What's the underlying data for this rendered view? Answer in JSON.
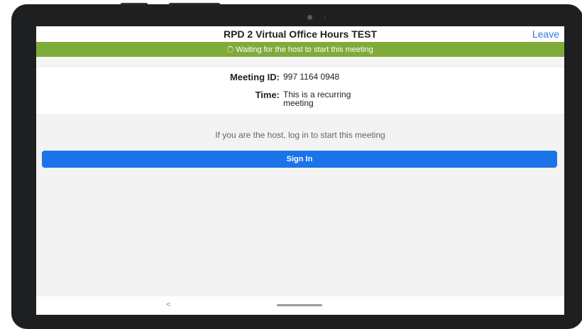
{
  "header": {
    "title": "RPD 2 Virtual Office Hours TEST",
    "leave_label": "Leave"
  },
  "status": {
    "text": "Waiting for the host to start this meeting",
    "icon": "spinner-icon",
    "color": "#7fab3a"
  },
  "meeting": {
    "id_label": "Meeting ID:",
    "id_value": "997 1164 0948",
    "time_label": "Time:",
    "time_value": "This is a recurring meeting"
  },
  "host_prompt": "If you are the host, log in to start this meeting",
  "sign_in_label": "Sign In",
  "navigation": {
    "back_icon": "chevron-left-icon",
    "back_glyph": "<",
    "home_icon": "home-pill-icon"
  },
  "colors": {
    "accent": "#1a73e8",
    "link": "#2d7bd8",
    "status_green": "#7fab3a",
    "device_frame": "#1e1f21"
  }
}
